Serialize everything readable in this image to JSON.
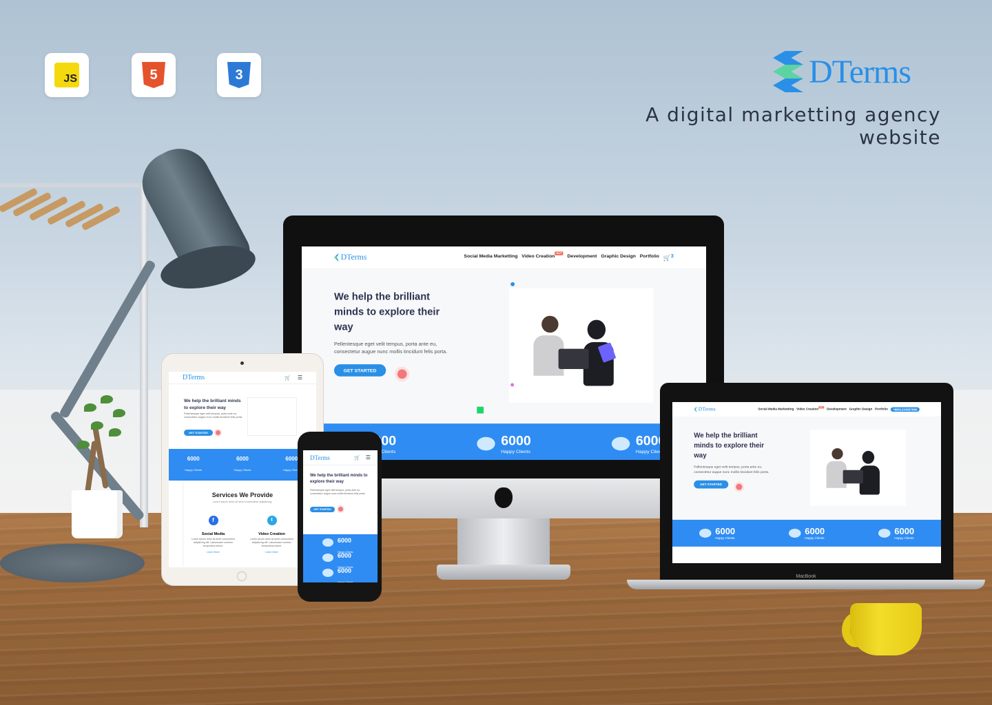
{
  "badges": [
    {
      "label": "JS",
      "icon": "javascript-icon",
      "color": "#f5d90f"
    },
    {
      "label": "5",
      "icon": "html5-icon",
      "color": "#e5532d"
    },
    {
      "label": "3",
      "icon": "css3-icon",
      "color": "#2d7ad6"
    }
  ],
  "brand": {
    "name": "DTerms",
    "tagline": "A digital marketting agency website",
    "colors": {
      "primary": "#2a8fe6",
      "accent": "#5bd4a1"
    }
  },
  "site": {
    "logo": "DTerms",
    "menu": [
      "Social Media Marketting",
      "Video Creation",
      "Development",
      "Graphic Design",
      "Portfolio"
    ],
    "hot_badge": "HOT",
    "cart_count": "3",
    "phone_pill": "+8801234567890",
    "hero": {
      "title": "We help the brilliant minds to explore their way",
      "body": "Pellentesque eget velit tempus, porta ante eu, consectetur augue nunc mollis tincidunt felis porta.",
      "cta": "GET STARTED"
    },
    "stats": [
      {
        "value": "6000",
        "label": "Happy Clients"
      },
      {
        "value": "6000",
        "label": "Happy Clients"
      },
      {
        "value": "6000",
        "label": "Happy Clients"
      }
    ],
    "services": {
      "title": "Services We Provide",
      "subtitle": "Lorem ipsum dolor sit amet consectetur adipisicing.",
      "items": [
        {
          "name": "Social Media",
          "text": "Lorem ipsum dolor sit amet consectetur adipisicing elit. Laboriosam nostrum temporibus dolore.",
          "link": "Learn More"
        },
        {
          "name": "Video Creation",
          "text": "Lorem ipsum dolor sit amet consectetur adipisicing elit. Laboriosam nostrum temporibus dolore.",
          "link": "Learn More"
        }
      ]
    }
  },
  "macbook_label": "MacBook"
}
